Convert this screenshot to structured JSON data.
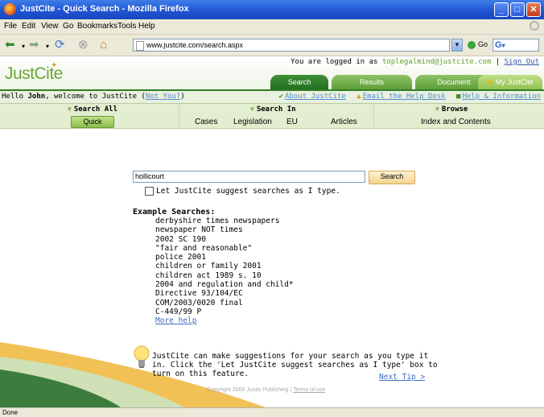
{
  "window": {
    "title": "JustCite - Quick Search - Mozilla Firefox"
  },
  "menubar": {
    "items": [
      "File",
      "Edit",
      "View",
      "Go",
      "Bookmarks",
      "Tools",
      "Help"
    ]
  },
  "navbar": {
    "url": "www.justcite.com/search.aspx",
    "go_label": "Go"
  },
  "header": {
    "logo": "JustCite",
    "logged_prefix": "You are logged in as ",
    "email": "toplegalmind@justcite.com",
    "sign_out": "Sign Out",
    "tabs": [
      "Search",
      "Results",
      "Document",
      "My JustCite"
    ]
  },
  "welcome": {
    "prefix": "Hello ",
    "name": "John",
    "suffix": ", welcome to JustCite (",
    "not_you": "Not You?",
    "close_paren": ")",
    "about": "About JustCite",
    "email_help": "Email the Help Desk",
    "help_info": "Help & Information"
  },
  "search_menu": {
    "search_all": "Search All",
    "quick": "Quick",
    "search_in": "Search In",
    "in_items": [
      "Cases",
      "Legislation",
      "EU",
      "Articles"
    ],
    "browse": "Browse",
    "browse_item": "Index and Contents"
  },
  "search": {
    "query": "hollicourt",
    "button": "Search",
    "suggest_label": "Let JustCite suggest searches as I type."
  },
  "examples": {
    "title": "Example Searches:",
    "items": [
      "derbyshire times newspapers",
      "newspaper NOT times",
      "2002 SC 190",
      "\"fair and reasonable\"",
      "police 2001",
      "children or family 2001",
      "children act 1989 s. 10",
      "2004 and regulation and child*",
      "Directive 93/104/EC",
      "COM/2003/0020 final",
      "C-449/99 P"
    ],
    "more_help": "More help"
  },
  "tip": {
    "text": "JustCite can make suggestions for your search as you type it in. Click the 'Let JustCite suggest searches as I type' box to turn on this feature.",
    "next": "Next Tip >"
  },
  "footer": {
    "copyright": "Copyright 2006 Justis Publishing | ",
    "terms": "Terms of use"
  },
  "status": {
    "text": "Done"
  },
  "colors": {
    "brand_green": "#6aa636",
    "dark_green": "#2f7d26",
    "link_blue": "#3d6cc4"
  }
}
